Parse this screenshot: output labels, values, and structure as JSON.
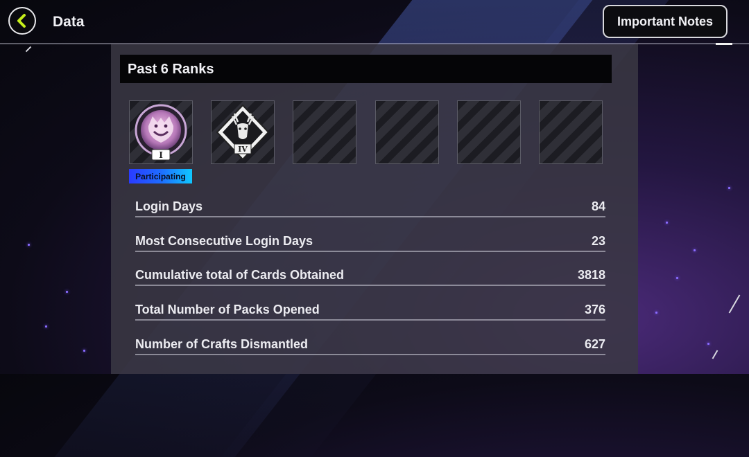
{
  "header": {
    "title": "Data",
    "notes_label": "Important Notes"
  },
  "ranks": {
    "title": "Past 6 Ranks",
    "slots": [
      {
        "icon": "white-tiger-rank-emblem-icon",
        "tier": "I",
        "badge": "Participating"
      },
      {
        "icon": "stag-rank-emblem-icon",
        "tier": "IV"
      },
      {
        "icon": "empty-slot"
      },
      {
        "icon": "empty-slot"
      },
      {
        "icon": "empty-slot"
      },
      {
        "icon": "empty-slot"
      }
    ]
  },
  "stats": [
    {
      "label": "Login Days",
      "value": "84"
    },
    {
      "label": "Most Consecutive Login Days",
      "value": "23"
    },
    {
      "label": "Cumulative total of Cards Obtained",
      "value": "3818"
    },
    {
      "label": "Total Number of Packs Opened",
      "value": "376"
    },
    {
      "label": "Number of Crafts Dismantled",
      "value": "627"
    }
  ],
  "colors": {
    "back_arrow": "#c6ef1a",
    "badge_gradient_start": "#2a3bff",
    "badge_gradient_end": "#10c8ff"
  }
}
